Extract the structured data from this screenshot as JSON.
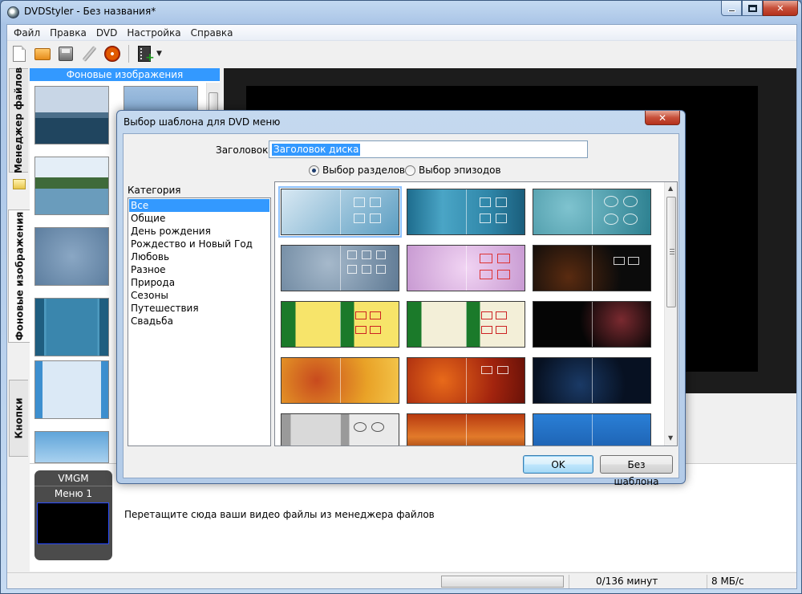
{
  "window": {
    "title": "DVDStyler - Без названия*",
    "minimize_glyph": "—",
    "close_glyph": "✕"
  },
  "menu": [
    "Файл",
    "Правка",
    "DVD",
    "Настройка",
    "Справка"
  ],
  "toolbar": {
    "icons": [
      "new-file-icon",
      "open-folder-icon",
      "save-icon",
      "settings-wrench-icon",
      "burn-dvd-icon",
      "add-video-icon"
    ],
    "dropdown_glyph": "▼",
    "plus_glyph": "+"
  },
  "side_tabs": {
    "file_manager": "Менеджер файлов",
    "backgrounds": "Фоновые изображения",
    "buttons": "Кнопки"
  },
  "backgrounds_panel": {
    "header": "Фоновые изображения"
  },
  "titleset": {
    "vmgm": "VMGM",
    "menu1": "Меню 1",
    "drop_hint": "Перетащите сюда ваши видео файлы из менеджера файлов"
  },
  "status": {
    "duration": "0/136 минут",
    "bitrate": "8 МБ/с"
  },
  "dialog": {
    "title": "Выбор шаблона для DVD меню",
    "close_glyph": "✕",
    "header_label": "Заголовок:",
    "header_value": "Заголовок диска",
    "radio_chapters": "Выбор разделов",
    "radio_episodes": "Выбор эпизодов",
    "selected_radio": "chapters",
    "category_label": "Категория",
    "categories": [
      "Все",
      "Общие",
      "День рождения",
      "Рождество и Новый Год",
      "Любовь",
      "Разное",
      "Природа",
      "Сезоны",
      "Путешествия",
      "Свадьба"
    ],
    "selected_category": "Все",
    "ok": "OK",
    "no_template": "Без шаблона",
    "scroll_up": "▲",
    "scroll_down": "▼"
  },
  "colors": {
    "selection": "#3399ff",
    "accent_header": "#3399ff"
  }
}
